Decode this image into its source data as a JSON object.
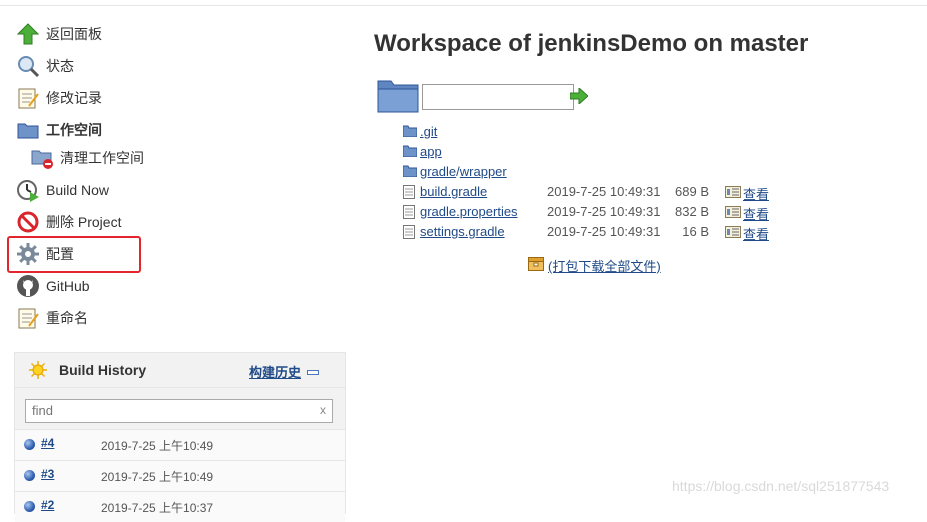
{
  "sidebar": {
    "items": [
      {
        "label": "返回面板",
        "icon": "up-arrow-icon"
      },
      {
        "label": "状态",
        "icon": "magnifier-icon"
      },
      {
        "label": "修改记录",
        "icon": "notepad-icon"
      },
      {
        "label": "工作空间",
        "icon": "folder-icon"
      },
      {
        "label": "清理工作空间",
        "icon": "folder-delete-icon"
      },
      {
        "label": "Build Now",
        "icon": "clock-play-icon"
      },
      {
        "label": "删除 Project",
        "icon": "no-entry-icon"
      },
      {
        "label": "配置",
        "icon": "gear-icon"
      },
      {
        "label": "GitHub",
        "icon": "github-icon"
      },
      {
        "label": "重命名",
        "icon": "notepad-icon"
      }
    ]
  },
  "build_history": {
    "title": "Build History",
    "title_zh": "构建历史",
    "search_placeholder": "find",
    "clear": "x",
    "builds": [
      {
        "number": "#4",
        "date": "2019-7-25 上午10:49"
      },
      {
        "number": "#3",
        "date": "2019-7-25 上午10:49"
      },
      {
        "number": "#2",
        "date": "2019-7-25 上午10:37"
      }
    ]
  },
  "workspace": {
    "title": "Workspace of jenkinsDemo on master",
    "path_value": "",
    "entries": [
      {
        "type": "folder",
        "name": ".git"
      },
      {
        "type": "folder",
        "name": "app"
      },
      {
        "type": "folder",
        "name": "gradle",
        "sub": "wrapper",
        "sep": "/"
      },
      {
        "type": "file",
        "name": "build.gradle",
        "date": "2019-7-25 10:49:31",
        "size": "689 B",
        "view": "查看"
      },
      {
        "type": "file",
        "name": "gradle.properties",
        "date": "2019-7-25 10:49:31",
        "size": "832 B",
        "view": "查看"
      },
      {
        "type": "file",
        "name": "settings.gradle",
        "date": "2019-7-25 10:49:31",
        "size": "16 B",
        "view": "查看"
      }
    ],
    "zip_label": "(打包下载全部文件)"
  },
  "watermark": "https://blog.csdn.net/sql251877543",
  "colors": {
    "link": "#204a87",
    "highlight": "#e3262e"
  }
}
